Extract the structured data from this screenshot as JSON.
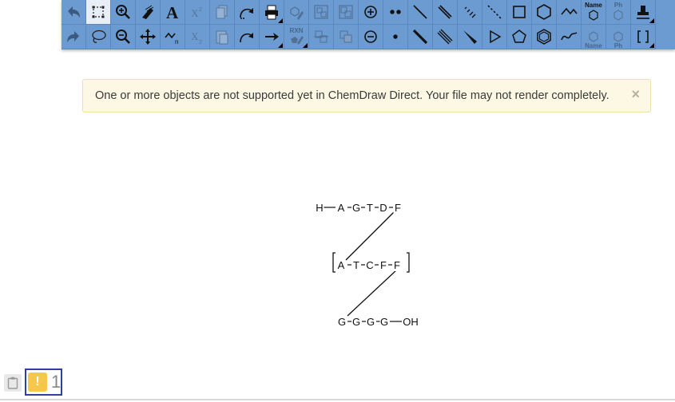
{
  "toolbar": {
    "row1": [
      {
        "name": "undo-icon",
        "state": "normal"
      },
      {
        "name": "marquee-select-icon",
        "state": "active"
      },
      {
        "name": "zoom-in-icon",
        "state": "normal"
      },
      {
        "name": "eraser-icon",
        "state": "normal"
      },
      {
        "name": "text-tool-icon",
        "state": "normal"
      },
      {
        "name": "superscript-icon",
        "state": "disabled"
      },
      {
        "name": "copy-icon",
        "state": "disabled"
      },
      {
        "name": "rotate-arrow-icon",
        "state": "normal"
      },
      {
        "name": "print-icon",
        "state": "normal"
      },
      {
        "name": "clean-structure-icon",
        "state": "disabled"
      },
      {
        "name": "group-icon",
        "state": "disabled"
      },
      {
        "name": "ungroup-icon",
        "state": "disabled"
      },
      {
        "name": "plus-charge-icon",
        "state": "normal"
      },
      {
        "name": "radical-pair-icon",
        "state": "normal"
      },
      {
        "name": "single-bond-icon",
        "state": "normal"
      },
      {
        "name": "double-bond-icon",
        "state": "normal"
      },
      {
        "name": "hashed-bond-icon",
        "state": "normal"
      },
      {
        "name": "dashed-bond-icon",
        "state": "normal"
      },
      {
        "name": "rectangle-icon",
        "state": "normal"
      },
      {
        "name": "hexagon-icon",
        "state": "normal"
      },
      {
        "name": "wavy-shape-icon",
        "state": "normal"
      },
      {
        "name": "name-to-structure-icon",
        "state": "normal",
        "label": "Name"
      },
      {
        "name": "phenyl-disabled-icon",
        "state": "disabled",
        "label": "Ph"
      },
      {
        "name": "stamp-icon",
        "state": "normal"
      }
    ],
    "row2": [
      {
        "name": "redo-icon",
        "state": "normal"
      },
      {
        "name": "lasso-select-icon",
        "state": "normal"
      },
      {
        "name": "zoom-out-icon",
        "state": "normal"
      },
      {
        "name": "move-icon",
        "state": "normal"
      },
      {
        "name": "chain-tool-icon",
        "state": "normal",
        "label": "n"
      },
      {
        "name": "subscript-icon",
        "state": "disabled"
      },
      {
        "name": "paste-icon",
        "state": "disabled"
      },
      {
        "name": "curved-arrow-icon",
        "state": "normal"
      },
      {
        "name": "reaction-arrow-icon",
        "state": "normal"
      },
      {
        "name": "rxn-clean-icon",
        "state": "disabled",
        "label": "RXN"
      },
      {
        "name": "align-icon",
        "state": "disabled"
      },
      {
        "name": "bring-front-icon",
        "state": "disabled"
      },
      {
        "name": "minus-charge-icon",
        "state": "normal"
      },
      {
        "name": "radical-icon",
        "state": "normal"
      },
      {
        "name": "bold-bond-icon",
        "state": "normal"
      },
      {
        "name": "triple-bond-icon",
        "state": "normal"
      },
      {
        "name": "wedge-bond-icon",
        "state": "normal"
      },
      {
        "name": "triangle-icon",
        "state": "normal"
      },
      {
        "name": "pentagon-icon",
        "state": "normal"
      },
      {
        "name": "benzene-icon",
        "state": "normal"
      },
      {
        "name": "freehand-icon",
        "state": "normal"
      },
      {
        "name": "name-structure-disabled-icon",
        "state": "disabled",
        "label": "Name"
      },
      {
        "name": "phenyl-structure-disabled-icon",
        "state": "disabled",
        "label": "Ph"
      },
      {
        "name": "brackets-icon",
        "state": "normal"
      }
    ]
  },
  "alert": {
    "message": "One or more objects are not supported yet in ChemDraw Direct. Your file may not render completely.",
    "close": "×"
  },
  "molecule": {
    "row1": [
      "H",
      "A",
      "G",
      "T",
      "D",
      "F"
    ],
    "row2": [
      "A",
      "T",
      "C",
      "F",
      "F"
    ],
    "row3": [
      "G",
      "G",
      "G",
      "G",
      "OH"
    ]
  },
  "status": {
    "warning_symbol": "!",
    "warning_count": "1"
  }
}
